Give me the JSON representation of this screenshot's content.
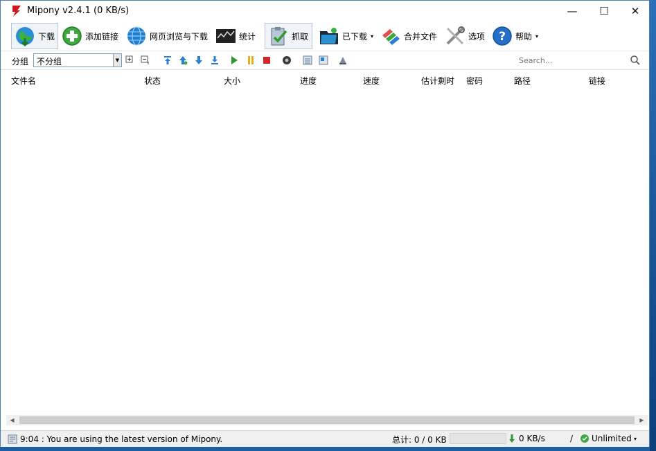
{
  "window": {
    "title": "Mipony v2.4.1 (0 KB/s)",
    "minimize_glyph": "—",
    "maximize_glyph": "☐",
    "close_glyph": "✕"
  },
  "toolbar": {
    "download": "下载",
    "add_link": "添加链接",
    "browse": "网页浏览与下载",
    "stats": "统计",
    "grab": "抓取",
    "downloaded": "已下载",
    "merge": "合并文件",
    "options": "选项",
    "help": "帮助",
    "caret": "▾"
  },
  "subbar": {
    "group_label": "分组",
    "group_value": "不分组",
    "search_placeholder": "Search..."
  },
  "columns": [
    "文件名",
    "状态",
    "大小",
    "进度",
    "速度",
    "估计剩时",
    "密码",
    "路径",
    "链接"
  ],
  "statusbar": {
    "message": "9:04 : You are using the latest version of Mipony.",
    "total": "总计: 0 / 0 KB",
    "speed": "0 KB/s",
    "separator": "/",
    "limit": "Unlimited"
  },
  "icons": {
    "app": "mipony-logo-icon",
    "download": "globe-download-icon",
    "add_link": "green-plus-icon",
    "browse": "globe-icon",
    "stats": "chart-monitor-icon",
    "grab": "clipboard-check-icon",
    "downloaded": "folder-dark-icon",
    "merge": "merge-files-icon",
    "options": "tools-icon",
    "help": "help-icon"
  },
  "colors": {
    "accent_blue": "#1a6fc4",
    "accent_green": "#2f9a2f",
    "title_logo_red": "#d01818"
  }
}
